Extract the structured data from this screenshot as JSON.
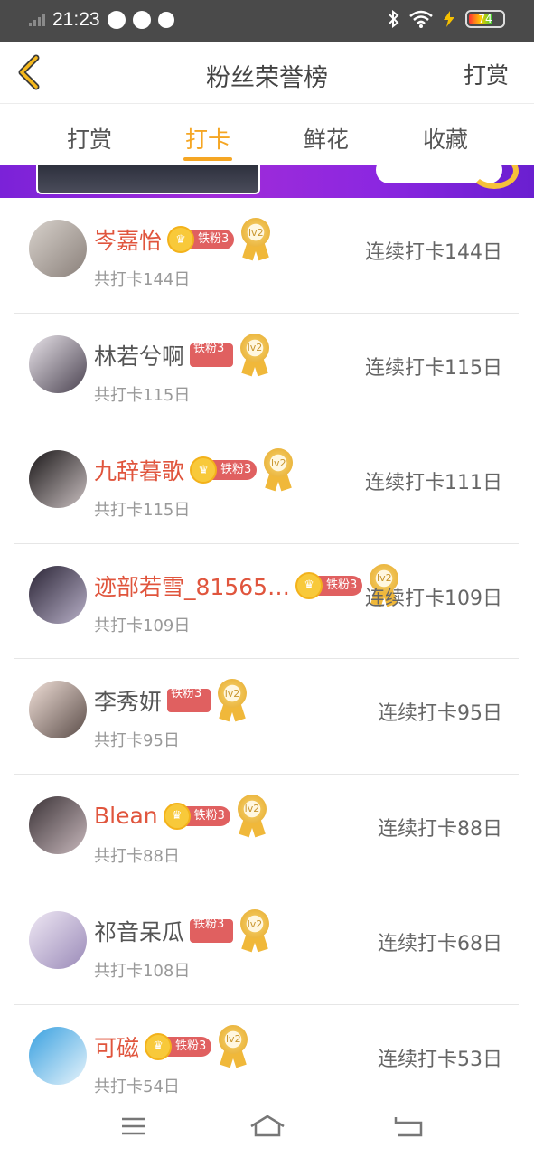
{
  "status_bar": {
    "time": "21:23",
    "battery_level": "74"
  },
  "header": {
    "title": "粉丝荣誉榜",
    "action_label": "打赏"
  },
  "tabs": [
    {
      "label": "打赏",
      "active": false
    },
    {
      "label": "打卡",
      "active": true
    },
    {
      "label": "鲜花",
      "active": false
    },
    {
      "label": "收藏",
      "active": false
    }
  ],
  "fans": [
    {
      "name": "岑嘉怡",
      "name_color": "red",
      "fan_label": "铁粉3",
      "badge_style": "crown",
      "medal": "lv2",
      "total": "共打卡144日",
      "streak": "连续打卡144日"
    },
    {
      "name": "林若兮啊",
      "name_color": "gray",
      "fan_label": "铁粉3",
      "badge_style": "plain",
      "medal": "lv2",
      "total": "共打卡115日",
      "streak": "连续打卡115日"
    },
    {
      "name": "九辞暮歌",
      "name_color": "red",
      "fan_label": "铁粉3",
      "badge_style": "crown",
      "medal": "lv2",
      "total": "共打卡115日",
      "streak": "连续打卡111日"
    },
    {
      "name": "迹部若雪_81565…",
      "name_color": "red",
      "fan_label": "铁粉3",
      "badge_style": "crown",
      "medal": "lv2",
      "total": "共打卡109日",
      "streak": "连续打卡109日"
    },
    {
      "name": "李秀妍",
      "name_color": "gray",
      "fan_label": "铁粉3",
      "badge_style": "plain",
      "medal": "lv2",
      "total": "共打卡95日",
      "streak": "连续打卡95日"
    },
    {
      "name": "Blean",
      "name_color": "red",
      "fan_label": "铁粉3",
      "badge_style": "crown",
      "medal": "lv2",
      "total": "共打卡88日",
      "streak": "连续打卡88日"
    },
    {
      "name": "祁音呆瓜",
      "name_color": "gray",
      "fan_label": "铁粉3",
      "badge_style": "plain",
      "medal": "lv2",
      "total": "共打卡108日",
      "streak": "连续打卡68日"
    },
    {
      "name": "可磁",
      "name_color": "red",
      "fan_label": "铁粉3",
      "badge_style": "crown",
      "medal": "lv2",
      "total": "共打卡54日",
      "streak": "连续打卡53日"
    }
  ],
  "colors": {
    "accent": "#f5a623",
    "vip_name": "#e0553d",
    "fan_pill": "#e06060",
    "status_bar": "#4a4a4a"
  },
  "navbar": {
    "icons": [
      "menu-icon",
      "home-icon",
      "back-icon"
    ]
  }
}
